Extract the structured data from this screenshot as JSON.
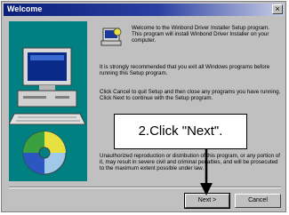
{
  "window": {
    "title": "Welcome",
    "close_glyph": "×"
  },
  "content": {
    "welcome": "Welcome to the Winbond Driver Installer Setup program. This program will install Winbond Driver Installer on your computer.",
    "paragraph1": "It is strongly recommended that you exit all Windows programs before running this Setup program.",
    "paragraph2": "Click Cancel to quit Setup and then close any programs you have running. Click Next to continue with the Setup program.",
    "paragraph3": "Unauthorized reproduction or distribution of this program, or any portion of it, may result in severe civil and criminal penalties, and will be prosecuted to the maximum extent possible under law."
  },
  "buttons": {
    "next_label": "Next >",
    "cancel_label": "Cancel"
  },
  "annotation": {
    "callout_text": "2.Click \"Next\"."
  },
  "icons": {
    "installer": "installer-icon",
    "computer": "computer-illustration-icon",
    "disc": "disc-icon",
    "close": "close-icon"
  },
  "colors": {
    "titlebar": "#0a1f7a",
    "panel": "#008080",
    "dialog": "#c0c0c0"
  }
}
